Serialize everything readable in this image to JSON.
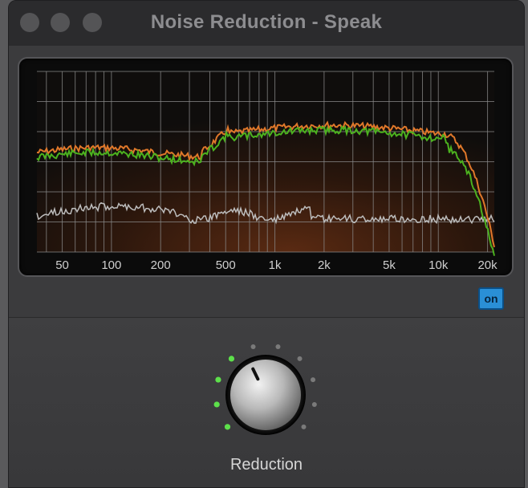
{
  "window": {
    "title": "Noise Reduction - Speak"
  },
  "analyzer": {
    "x_tick_labels": [
      "50",
      "100",
      "200",
      "500",
      "1k",
      "2k",
      "5k",
      "10k",
      "20k"
    ],
    "series_colors": {
      "input": "#e0782a",
      "output": "#4cb21f",
      "noise": "#bdbdbd"
    }
  },
  "on_button": {
    "label": "on",
    "state": "on",
    "color": "#2a8fd6"
  },
  "knob": {
    "label": "Reduction",
    "level": 0.4,
    "leds_total": 10,
    "leds_lit": 4,
    "led_on_color": "#5de04b"
  }
}
